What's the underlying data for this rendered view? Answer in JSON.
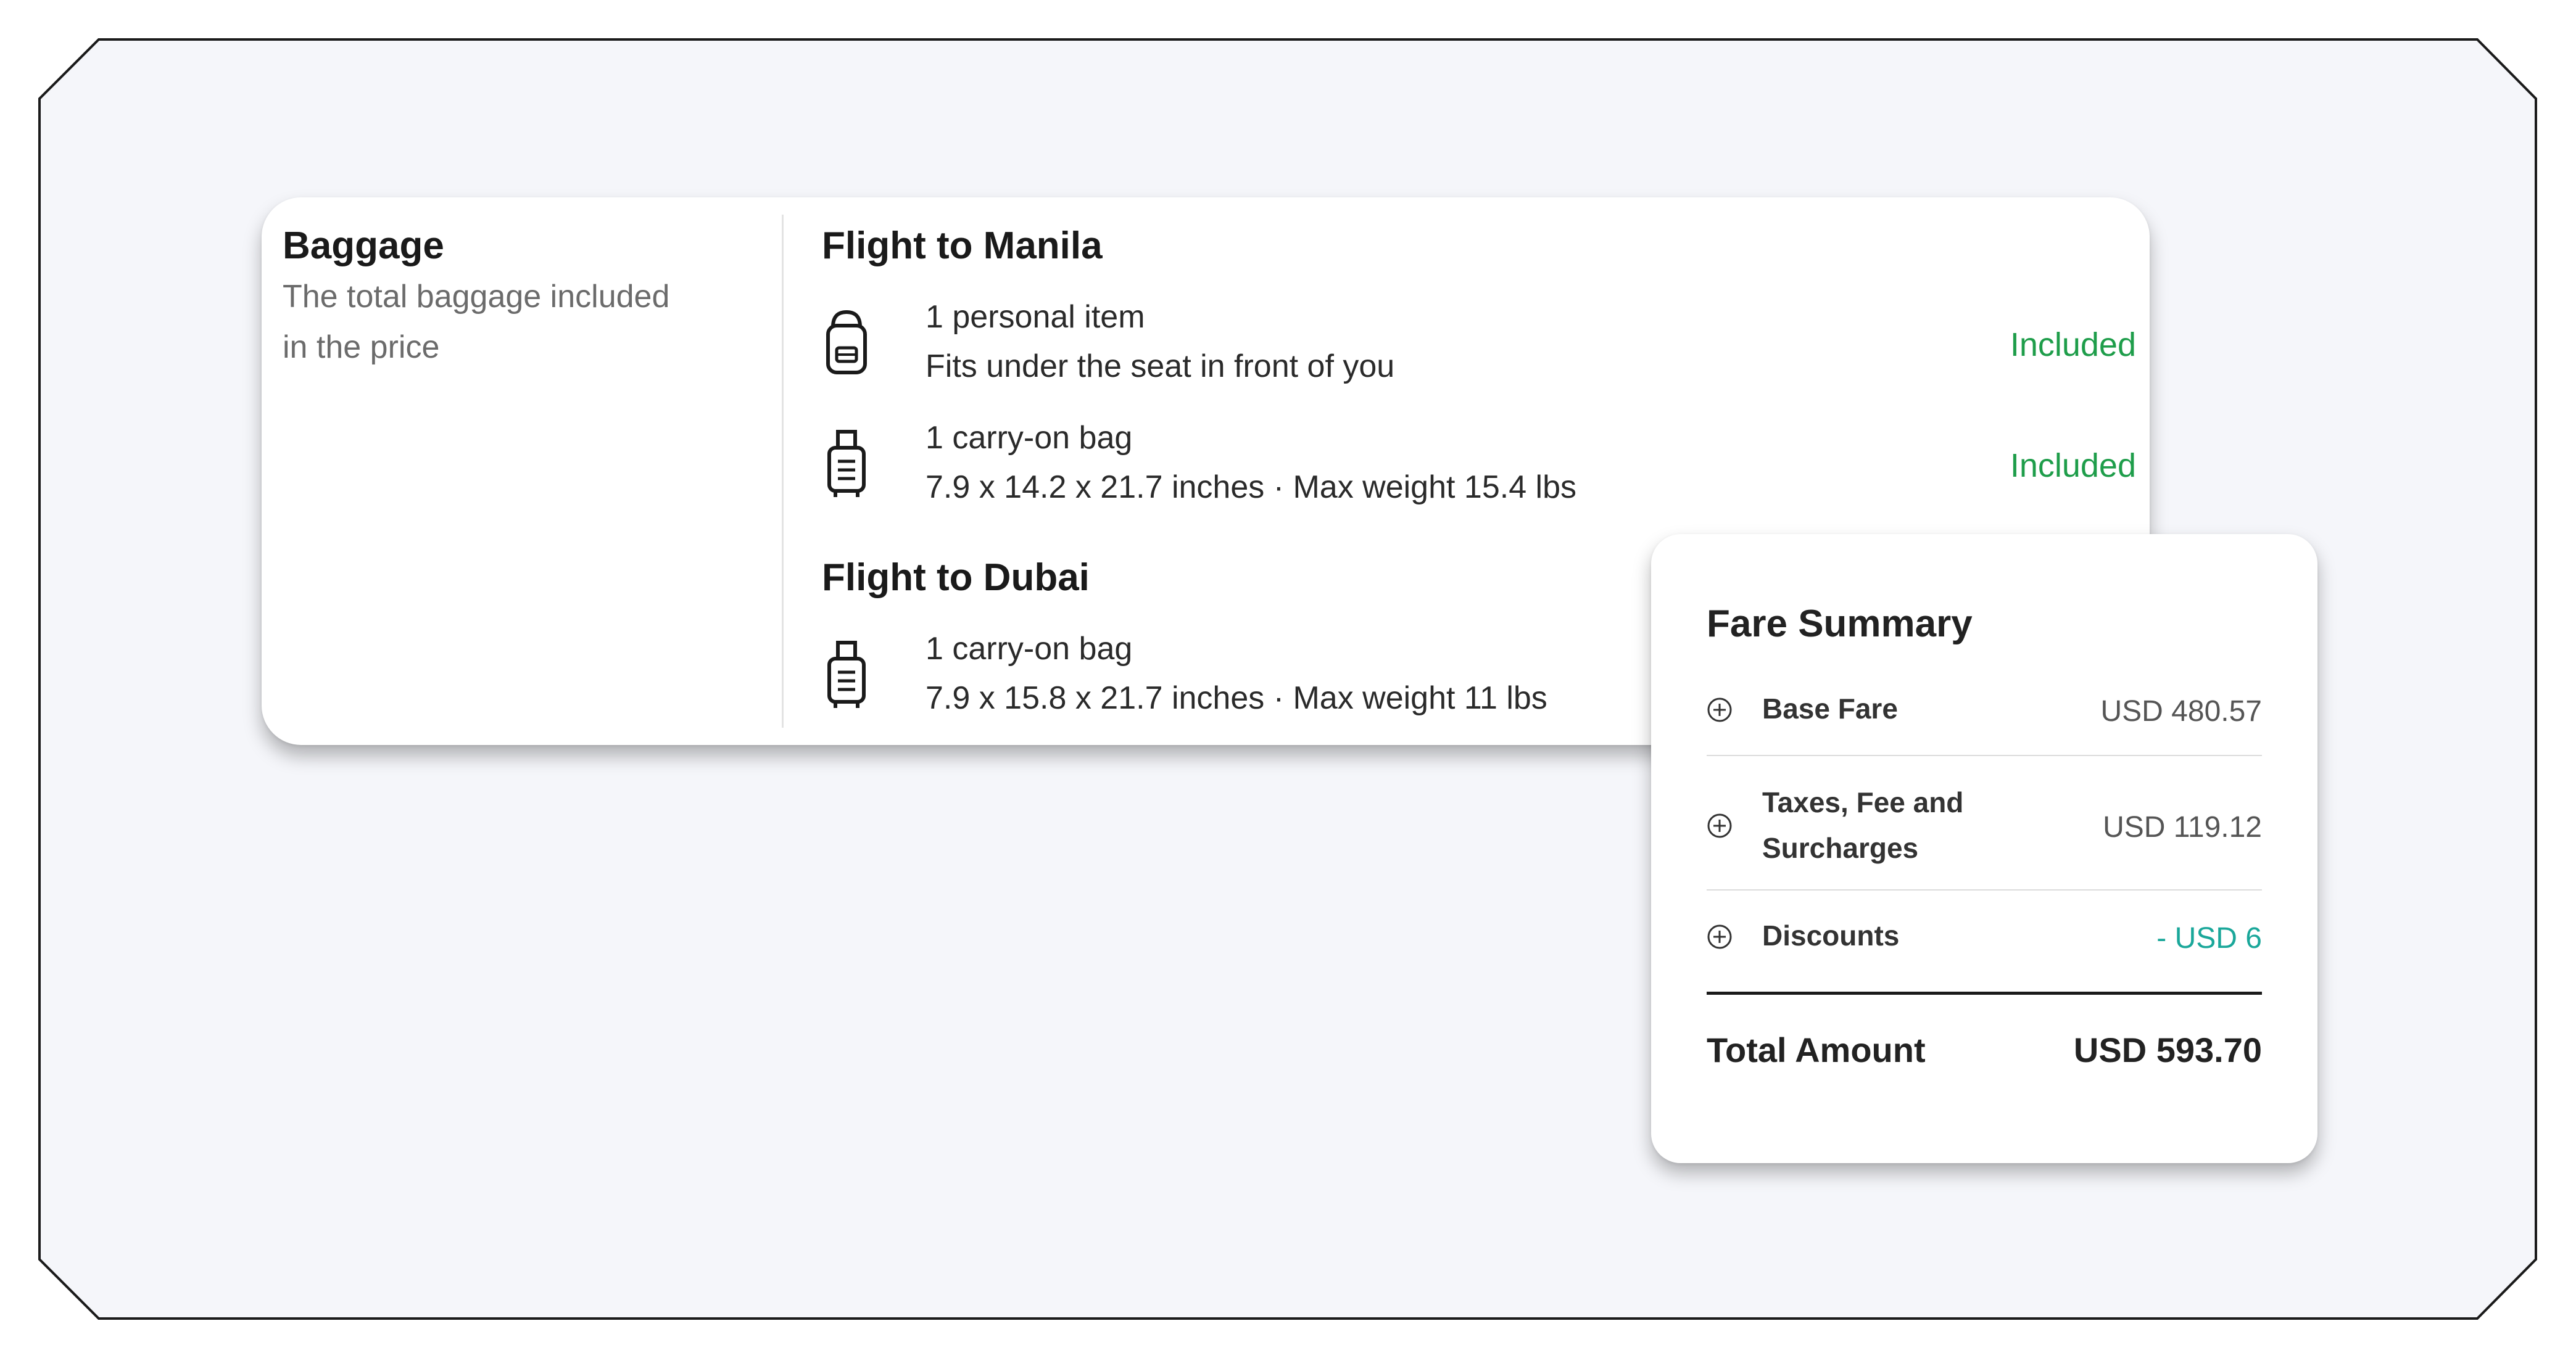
{
  "baggage": {
    "title": "Baggage",
    "subtitle_line1": "The total baggage included",
    "subtitle_line2": "in the price",
    "flights": [
      {
        "title": "Flight to Manila",
        "items": [
          {
            "icon": "backpack-icon",
            "line1": "1 personal item",
            "line2": "Fits under the seat in front of you",
            "status": "Included"
          },
          {
            "icon": "carry-on-bag-icon",
            "line1": "1 carry-on bag",
            "line2": "7.9 x 14.2 x 21.7 inches · Max weight 15.4 lbs",
            "status": "Included"
          }
        ]
      },
      {
        "title": "Flight to Dubai",
        "items": [
          {
            "icon": "carry-on-bag-icon",
            "line1": "1 carry-on bag",
            "line2": "7.9 x 15.8 x 21.7 inches · Max weight 11 lbs"
          }
        ]
      }
    ]
  },
  "fare_summary": {
    "title": "Fare Summary",
    "rows": [
      {
        "icon": "plus-circle-icon",
        "label": "Base Fare",
        "value": "USD 480.57"
      },
      {
        "icon": "plus-circle-icon",
        "label_line1": "Taxes, Fee and",
        "label_line2": "Surcharges",
        "value": "USD 119.12"
      },
      {
        "icon": "plus-circle-icon",
        "label": "Discounts",
        "value": "- USD 6"
      }
    ],
    "total_label": "Total Amount",
    "total_value": "USD 593.70"
  },
  "colors": {
    "background": "#f5f6fa",
    "included": "#1e9d4a",
    "discount": "#1aa79a",
    "text_dark": "#1a1a1a"
  }
}
